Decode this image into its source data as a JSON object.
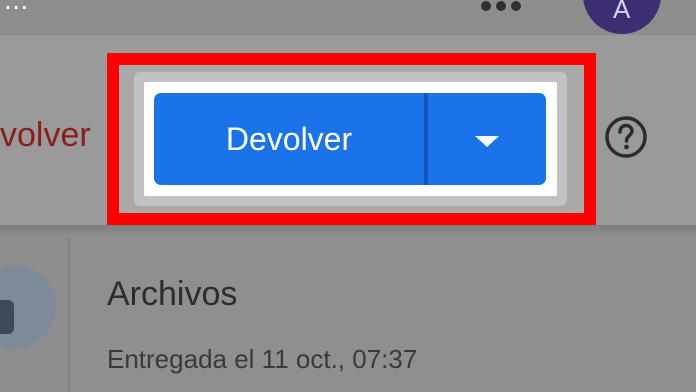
{
  "top_bar": {
    "cut_off_text": "...",
    "more_options_icon": "more-horizontal-icon",
    "avatar_letter": "A"
  },
  "header": {
    "return_link_label": "volver",
    "primary_button_label": "Devolver",
    "dropdown_icon": "caret-down-icon",
    "help_icon": "help-circle-icon"
  },
  "content": {
    "files_title": "Archivos",
    "delivered_status": "Entregada el 11 oct., 07:37"
  },
  "colors": {
    "primary": "#1a73e8",
    "highlight": "#ff0000",
    "return_link": "#8a1d1d",
    "avatar": "#3d2d73"
  }
}
